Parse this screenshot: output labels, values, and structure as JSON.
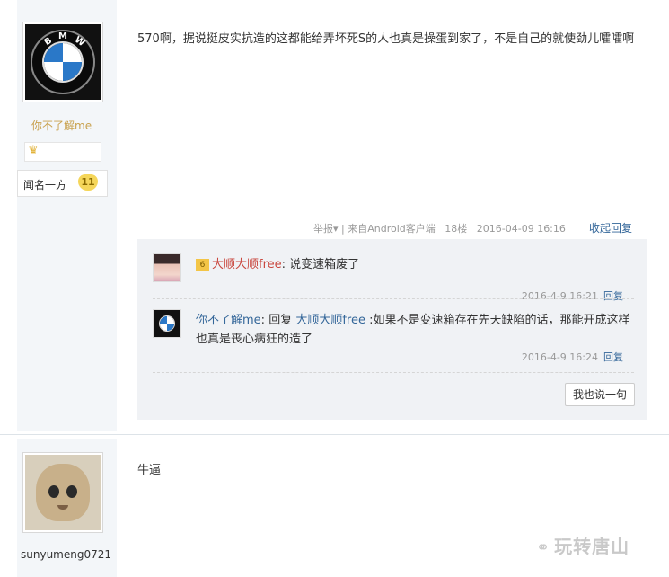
{
  "post1": {
    "username": "你不了解me",
    "rank_label": "闻名一方",
    "level": "11",
    "content": "570啊，据说挺皮实抗造的这都能给弄坏死S的人也真是操蛋到家了，不是自己的就使劲儿嚯嚯啊",
    "report_label": "举报",
    "source": "来自Android客户端",
    "floor": "18楼",
    "timestamp": "2016-04-09 16:16",
    "collapse_label": "收起回复",
    "comments": [
      {
        "user": "大顺大顺free",
        "text": "说变速箱废了",
        "time": "2016-4-9 16:21",
        "reply_label": "回复"
      },
      {
        "user": "你不了解me",
        "reply_word": "回复",
        "reply_to": "大顺大顺free",
        "text": ":如果不是变速箱存在先天缺陷的话，那能开成这样也真是丧心病狂的造了",
        "time": "2016-4-9 16:24",
        "reply_label": "回复"
      }
    ],
    "say_button": "我也说一句"
  },
  "post2": {
    "username": "sunyumeng0721",
    "content": "牛逼"
  },
  "watermark": "玩转唐山"
}
